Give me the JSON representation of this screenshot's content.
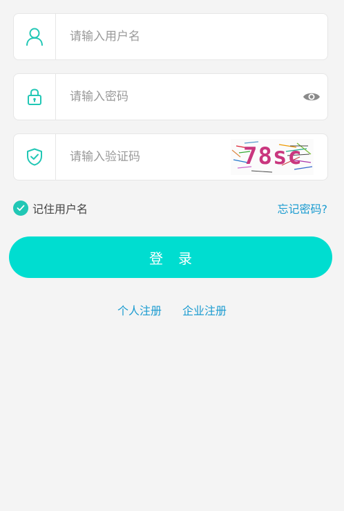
{
  "username": {
    "placeholder": "请输入用户名",
    "icon": "user-icon"
  },
  "password": {
    "placeholder": "请输入密码",
    "icon": "lock-icon",
    "toggle_icon": "eye-icon"
  },
  "captcha": {
    "placeholder": "请输入验证码",
    "icon": "shield-check-icon",
    "code": "78sc"
  },
  "options": {
    "remember_label": "记住用户名",
    "remember_checked": true,
    "forgot_label": "忘记密码?"
  },
  "login": {
    "label": "登录"
  },
  "register": {
    "personal_label": "个人注册",
    "enterprise_label": "企业注册"
  },
  "colors": {
    "accent": "#00ddd0",
    "link": "#1a9bd0",
    "icon": "#21c7b5",
    "background": "#f4f4f4"
  }
}
